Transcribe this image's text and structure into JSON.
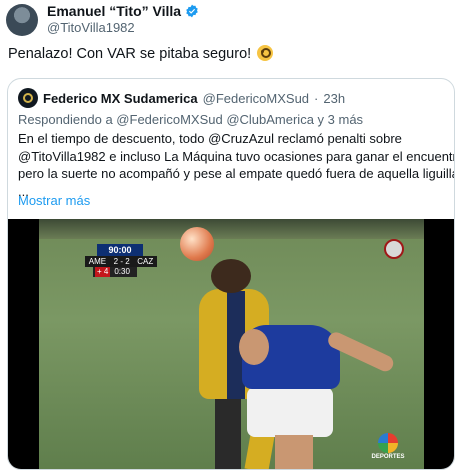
{
  "tweet": {
    "display_name": "Emanuel “Tito” Villa",
    "handle": "@TitoVilla1982",
    "text": "Penalazo! Con VAR se pitaba seguro!",
    "emoji": "face-with-monocle-icon"
  },
  "quote": {
    "display_name": "Federico MX Sudamerica",
    "handle": "@FedericoMXSud",
    "separator": "·",
    "time": "23h",
    "replying_to": "Respondiendo a @FedericoMXSud @ClubAmerica y 3 más",
    "body_lines": [
      "En el tiempo de descuento, todo @CruzAzul reclamó penalti sobre",
      "@TitoVilla1982 e incluso La Máquina tuvo ocasiones para ganar el encuentro",
      "pero la suerte no acompañó y pese al empate quedó fuera de aquella liguilla",
      "..."
    ],
    "show_more": "Mostrar más"
  },
  "video": {
    "clock": "90:00",
    "home": "AME",
    "score": "2 - 2",
    "away": "CAZ",
    "added_time": "+ 4",
    "extra_clock": "0:30",
    "broadcaster_logo_text": "DEPORTES"
  },
  "colors": {
    "verified": "#1d9bf0",
    "link": "#1d9bf0",
    "secondary_text": "#536471",
    "border": "#cfd9de"
  }
}
